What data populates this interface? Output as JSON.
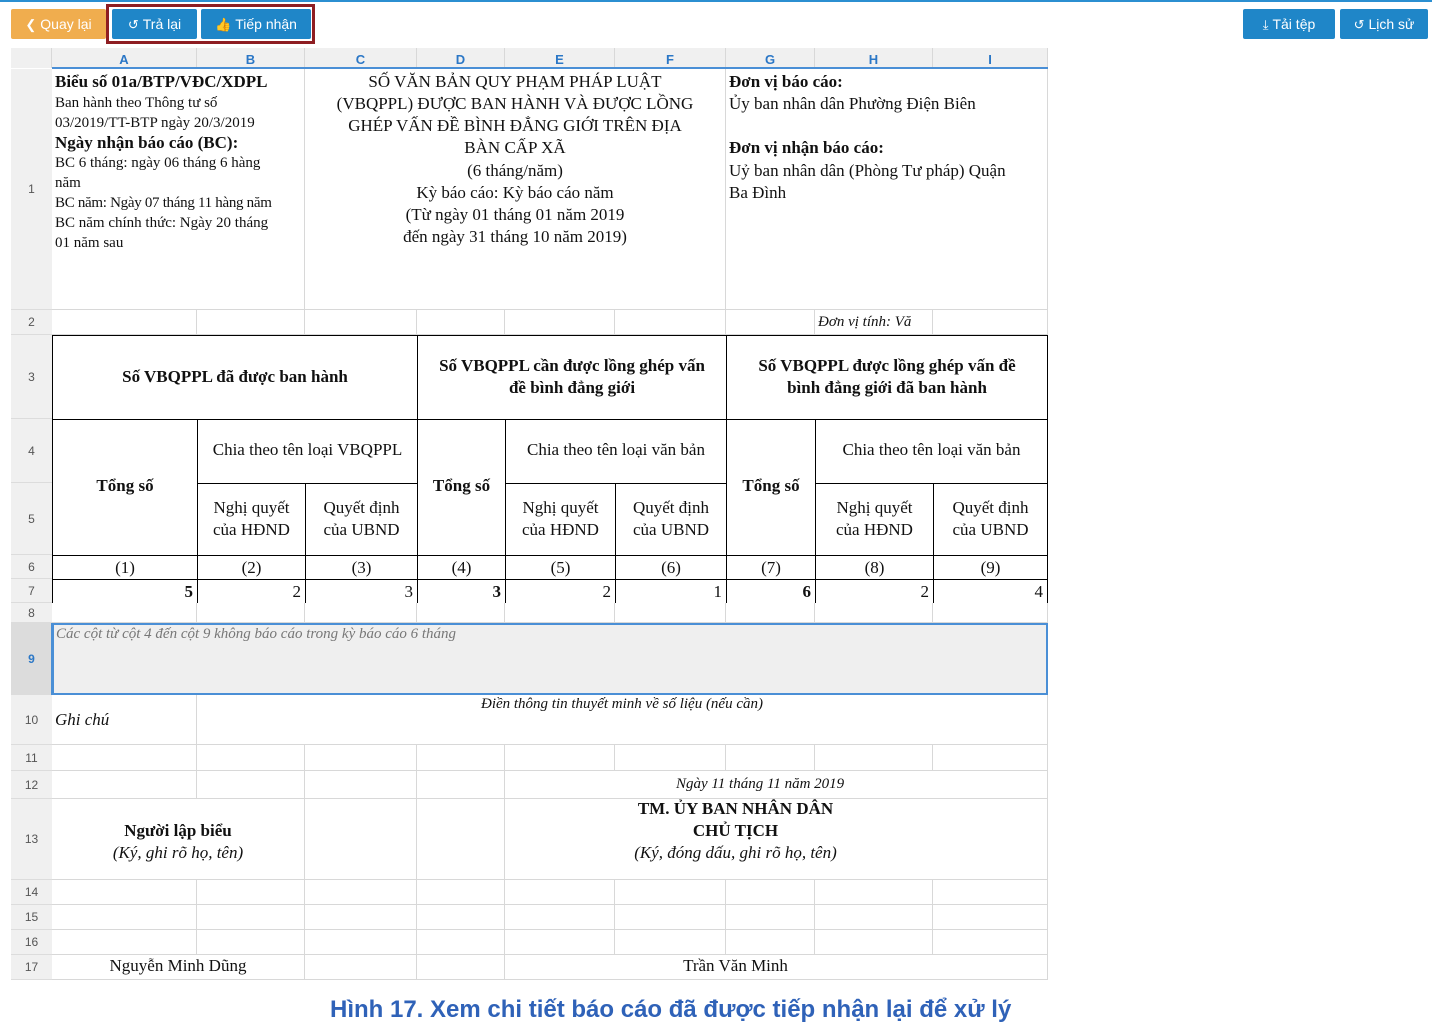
{
  "toolbar": {
    "back_label": "Quay lại",
    "return_label": "Trả lại",
    "accept_label": "Tiếp nhận",
    "download_label": "Tải tệp",
    "history_label": "Lịch sử"
  },
  "sheet": {
    "columns": [
      "A",
      "B",
      "C",
      "D",
      "E",
      "F",
      "G",
      "H",
      "I"
    ],
    "rows": [
      "1",
      "2",
      "3",
      "4",
      "5",
      "6",
      "7",
      "8",
      "9",
      "10",
      "11",
      "12",
      "13",
      "14",
      "15",
      "16",
      "17"
    ],
    "form": {
      "code": "Biểu số 01a/BTP/VĐC/XDPL",
      "issued_line1": "Ban hành theo Thông tư số",
      "issued_line2": "03/2019/TT-BTP ngày 20/3/2019",
      "receive_title": "Ngày nhận báo cáo (BC):",
      "bc6_line1": "BC 6 tháng: ngày 06 tháng 6 hàng",
      "bc6_line2": "năm",
      "bcyear": "BC năm: Ngày 07 tháng 11 hàng năm",
      "bcofficial_line1": "BC năm chính thức: Ngày 20 tháng",
      "bcofficial_line2": "01 năm sau"
    },
    "title": {
      "line1": "SỐ VĂN BẢN QUY PHẠM PHÁP LUẬT",
      "line2": "(VBQPPL) ĐƯỢC BAN HÀNH VÀ ĐƯỢC LỒNG",
      "line3": "GHÉP VẤN ĐỀ BÌNH ĐẲNG GIỚI TRÊN ĐỊA",
      "line4": "BÀN CẤP XÃ",
      "line5": "(6 tháng/năm)",
      "line6": "Kỳ báo cáo: Kỳ báo cáo năm",
      "line7": "(Từ ngày 01 tháng 01 năm 2019",
      "line8": "đến ngày 31 tháng 10 năm 2019)"
    },
    "unit": {
      "report_label": "Đơn vị báo cáo:",
      "report_value": "Ủy ban nhân dân Phường Điện Biên",
      "receive_label": "Đơn vị nhận báo cáo:",
      "receive_value_line1": "Uỷ ban nhân dân (Phòng Tư pháp) Quận",
      "receive_value_line2": "Ba Đình",
      "measure": "Đơn vị tính: Vă"
    },
    "headers": {
      "group1": "Số VBQPPL đã được ban hành",
      "group2_line1": "Số VBQPPL cần được lồng ghép vấn",
      "group2_line2": "đề bình đẳng giới",
      "group3_line1": "Số VBQPPL được lồng ghép vấn đề",
      "group3_line2": "bình đẳng giới đã ban hành",
      "total": "Tổng số",
      "split_vbqppl": "Chia theo tên loại VBQPPL",
      "split_vanban": "Chia theo tên loại văn bản",
      "nq_line1": "Nghị quyết",
      "nq_line2": "của HĐND",
      "qd_line1": "Quyết định",
      "qd_line2": "của UBND"
    },
    "col_numbers": [
      "(1)",
      "(2)",
      "(3)",
      "(4)",
      "(5)",
      "(6)",
      "(7)",
      "(8)",
      "(9)"
    ],
    "values": [
      "5",
      "2",
      "3",
      "3",
      "2",
      "1",
      "6",
      "2",
      "4"
    ],
    "note_row9": "Các cột từ cột 4 đến cột 9 không báo cáo trong kỳ báo cáo 6 tháng",
    "note_label": "Ghi chú",
    "note_hint": "Điền thông tin thuyết minh về số liệu (nếu cần)",
    "date_line": "Ngày 11 tháng 11 năm 2019",
    "preparer_title": "Người lập biểu",
    "preparer_sub": "(Ký, ghi rõ họ, tên)",
    "chair_line1": "TM. ỦY BAN NHÂN DÂN",
    "chair_line2": "CHỦ TỊCH",
    "chair_sub": "(Ký, đóng dấu, ghi rõ họ, tên)",
    "preparer_name": "Nguyễn Minh Dũng",
    "chair_name": "Trần Văn Minh"
  },
  "caption": "Hình 17. Xem chi tiết báo cáo đã được tiếp nhận lại để xử lý"
}
